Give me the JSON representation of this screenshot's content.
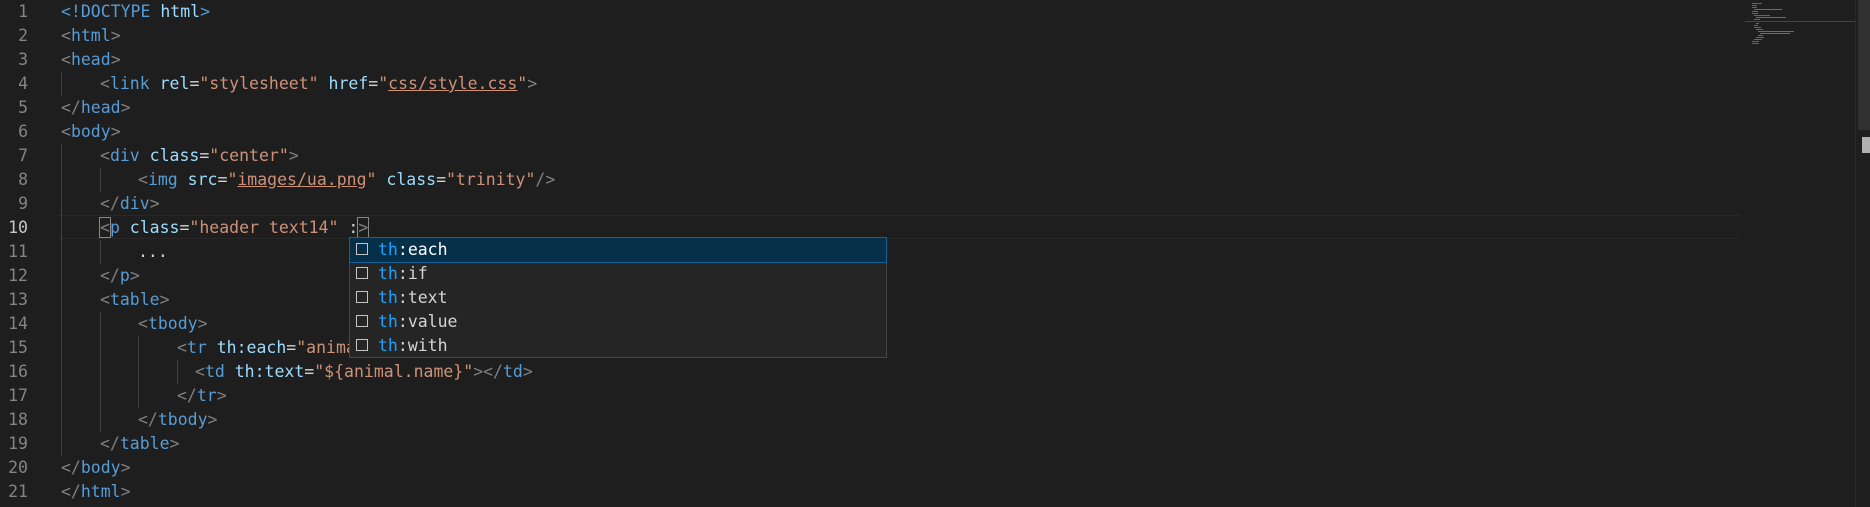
{
  "editor": {
    "active_line": "10",
    "line_numbers": [
      "1",
      "2",
      "3",
      "4",
      "5",
      "6",
      "7",
      "8",
      "9",
      "10",
      "11",
      "12",
      "13",
      "14",
      "15",
      "16",
      "17",
      "18",
      "19",
      "20",
      "21"
    ],
    "lines": {
      "l1": {
        "p1": "<!",
        "t1": "DOCTYPE",
        "a1": " html",
        "p2": ">"
      },
      "l2": {
        "p1": "<",
        "t1": "html",
        "p2": ">"
      },
      "l3": {
        "p1": "<",
        "t1": "head",
        "p2": ">"
      },
      "l4": {
        "p1": "<",
        "t1": "link",
        "a1": " rel",
        "eq1": "=",
        "s1": "\"stylesheet\"",
        "a2": " href",
        "eq2": "=",
        "s2a": "\"",
        "s2": "css/style.css",
        "s2b": "\"",
        "p2": ">"
      },
      "l5": {
        "p1": "</",
        "t1": "head",
        "p2": ">"
      },
      "l6": {
        "p1": "<",
        "t1": "body",
        "p2": ">"
      },
      "l7": {
        "p1": "<",
        "t1": "div",
        "a1": " class",
        "eq1": "=",
        "s1": "\"center\"",
        "p2": ">"
      },
      "l8": {
        "p1": "<",
        "t1": "img",
        "a1": " src",
        "eq1": "=",
        "s1a": "\"",
        "s1": "images/ua.png",
        "s1b": "\"",
        "a2": " class",
        "eq2": "=",
        "s2": "\"trinity\"",
        "p2": "/>"
      },
      "l9": {
        "p1": "</",
        "t1": "div",
        "p2": ">"
      },
      "l10": {
        "p1": "<",
        "t1": "p",
        "a1": " class",
        "eq1": "=",
        "s1": "\"header text14\"",
        "w1": " :",
        "p2": ">"
      },
      "l11": {
        "w1": "..."
      },
      "l12": {
        "p1": "</",
        "t1": "p",
        "p2": ">"
      },
      "l13": {
        "p1": "<",
        "t1": "table",
        "p2": ">"
      },
      "l14": {
        "p1": "<",
        "t1": "tbody",
        "p2": ">"
      },
      "l15": {
        "p1": "<",
        "t1": "tr",
        "a1": " th:each",
        "eq1": "=",
        "s1": "\"anima"
      },
      "l16": {
        "p1": "<",
        "t1": "td",
        "a1": " th:text",
        "eq1": "=",
        "s1": "\"${animal.name}\"",
        "p2": "></",
        "t2": "td",
        "p3": ">"
      },
      "l17": {
        "p1": "</",
        "t1": "tr",
        "p2": ">"
      },
      "l18": {
        "p1": "</",
        "t1": "tbody",
        "p2": ">"
      },
      "l19": {
        "p1": "</",
        "t1": "table",
        "p2": ">"
      },
      "l20": {
        "p1": "</",
        "t1": "body",
        "p2": ">"
      },
      "l21": {
        "p1": "</",
        "t1": "html",
        "p2": ">"
      }
    }
  },
  "suggest": {
    "items": [
      {
        "prefix": "th",
        "colon": ":",
        "name": "each",
        "selected": true,
        "icon": "snippet-icon"
      },
      {
        "prefix": "th",
        "colon": ":",
        "name": "if",
        "selected": false,
        "icon": "snippet-icon"
      },
      {
        "prefix": "th",
        "colon": ":",
        "name": "text",
        "selected": false,
        "icon": "snippet-icon"
      },
      {
        "prefix": "th",
        "colon": ":",
        "name": "value",
        "selected": false,
        "icon": "snippet-icon"
      },
      {
        "prefix": "th",
        "colon": ":",
        "name": "with",
        "selected": false,
        "icon": "snippet-icon"
      }
    ]
  },
  "colors": {
    "background": "#1e1e1e",
    "tag": "#569cd6",
    "attribute": "#9cdcfe",
    "string": "#ce9178",
    "punctuation": "#808080",
    "line_number": "#858585",
    "suggest_selected": "#062f4a",
    "suggest_highlight": "#18a3ff"
  }
}
